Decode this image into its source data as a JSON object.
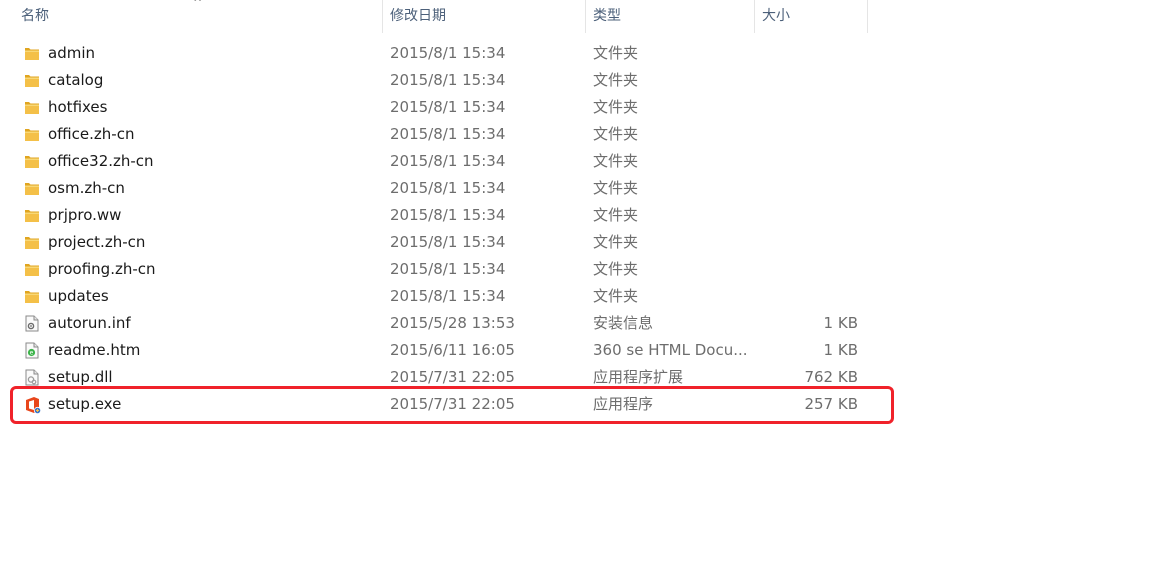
{
  "columns": {
    "name": "名称",
    "date": "修改日期",
    "type": "类型",
    "size": "大小"
  },
  "sort_indicator": "^",
  "files": [
    {
      "name": "admin",
      "date": "2015/8/1 15:34",
      "type": "文件夹",
      "size": "",
      "icon": "folder-icon"
    },
    {
      "name": "catalog",
      "date": "2015/8/1 15:34",
      "type": "文件夹",
      "size": "",
      "icon": "folder-icon"
    },
    {
      "name": "hotfixes",
      "date": "2015/8/1 15:34",
      "type": "文件夹",
      "size": "",
      "icon": "folder-icon"
    },
    {
      "name": "office.zh-cn",
      "date": "2015/8/1 15:34",
      "type": "文件夹",
      "size": "",
      "icon": "folder-icon"
    },
    {
      "name": "office32.zh-cn",
      "date": "2015/8/1 15:34",
      "type": "文件夹",
      "size": "",
      "icon": "folder-icon"
    },
    {
      "name": "osm.zh-cn",
      "date": "2015/8/1 15:34",
      "type": "文件夹",
      "size": "",
      "icon": "folder-icon"
    },
    {
      "name": "prjpro.ww",
      "date": "2015/8/1 15:34",
      "type": "文件夹",
      "size": "",
      "icon": "folder-icon"
    },
    {
      "name": "project.zh-cn",
      "date": "2015/8/1 15:34",
      "type": "文件夹",
      "size": "",
      "icon": "folder-icon"
    },
    {
      "name": "proofing.zh-cn",
      "date": "2015/8/1 15:34",
      "type": "文件夹",
      "size": "",
      "icon": "folder-icon"
    },
    {
      "name": "updates",
      "date": "2015/8/1 15:34",
      "type": "文件夹",
      "size": "",
      "icon": "folder-icon"
    },
    {
      "name": "autorun.inf",
      "date": "2015/5/28 13:53",
      "type": "安装信息",
      "size": "1 KB",
      "icon": "settings-file-icon"
    },
    {
      "name": "readme.htm",
      "date": "2015/6/11 16:05",
      "type": "360 se HTML Docu...",
      "size": "1 KB",
      "icon": "html-file-icon"
    },
    {
      "name": "setup.dll",
      "date": "2015/7/31 22:05",
      "type": "应用程序扩展",
      "size": "762 KB",
      "icon": "dll-file-icon"
    },
    {
      "name": "setup.exe",
      "date": "2015/7/31 22:05",
      "type": "应用程序",
      "size": "257 KB",
      "icon": "office-setup-icon"
    }
  ],
  "colors": {
    "folder": "#f4c048",
    "header_text": "#4c607a",
    "highlight": "#f0222a",
    "office_orange": "#e8461b"
  }
}
